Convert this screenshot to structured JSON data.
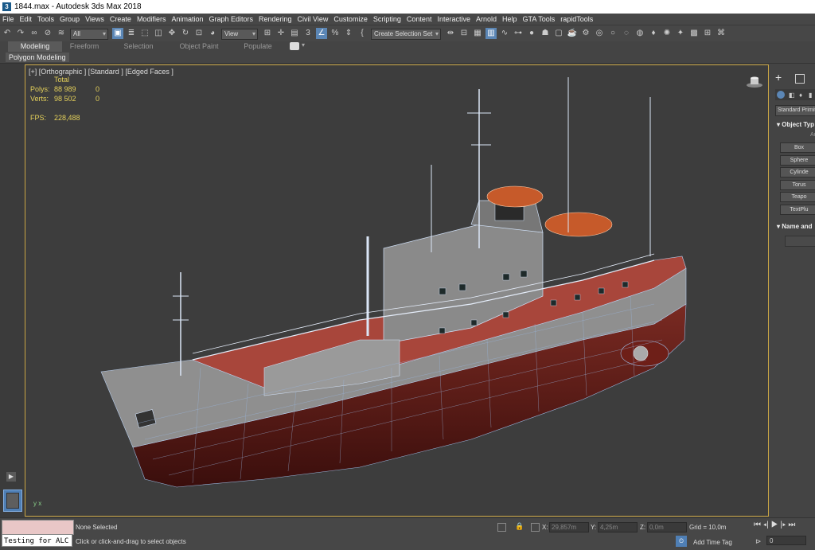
{
  "window": {
    "title": "1844.max - Autodesk 3ds Max 2018",
    "app_icon": "3ds-max-icon"
  },
  "menu": [
    "File",
    "Edit",
    "Tools",
    "Group",
    "Views",
    "Create",
    "Modifiers",
    "Animation",
    "Graph Editors",
    "Rendering",
    "Civil View",
    "Customize",
    "Scripting",
    "Content",
    "Interactive",
    "Arnold",
    "Help",
    "GTA Tools",
    "rapidTools"
  ],
  "toolbar": {
    "selection_filter": "All",
    "ref_coord": "View",
    "selection_set": "Create Selection Set"
  },
  "ribbon": {
    "tabs": [
      "Modeling",
      "Freeform",
      "Selection",
      "Object Paint",
      "Populate"
    ],
    "active_tab": "Modeling",
    "panel_label": "Polygon Modeling"
  },
  "viewport": {
    "label": "[+] [Orthographic ] [Standard ] [Edged Faces ]",
    "stats": {
      "total_label": "Total",
      "polys_label": "Polys:",
      "polys_total": "88 989",
      "polys_sel": "0",
      "verts_label": "Verts:",
      "verts_total": "98 502",
      "verts_sel": "0",
      "fps_label": "FPS:",
      "fps": "228,488"
    },
    "accent_color": "#c9a544",
    "axis": {
      "x": "x",
      "y": "y"
    }
  },
  "command_panel": {
    "category": "Standard Primiti",
    "rollout_object_type": "Object Typ",
    "auto_grid": "Au",
    "buttons": [
      "Box",
      "Sphere",
      "Cylinde",
      "Torus",
      "Teapo",
      "TextPlu"
    ],
    "rollout_name": "Name and"
  },
  "status": {
    "selection": "None Selected",
    "prompt": "Click or click-and-drag to select objects",
    "listener_text": "Testing for ALC",
    "x_label": "X:",
    "x": "29,857m",
    "y_label": "Y:",
    "y": "4,25m",
    "z_label": "Z:",
    "z": "0,0m",
    "grid": "Grid = 10,0m",
    "add_time_tag": "Add Time Tag",
    "frame": "0"
  }
}
